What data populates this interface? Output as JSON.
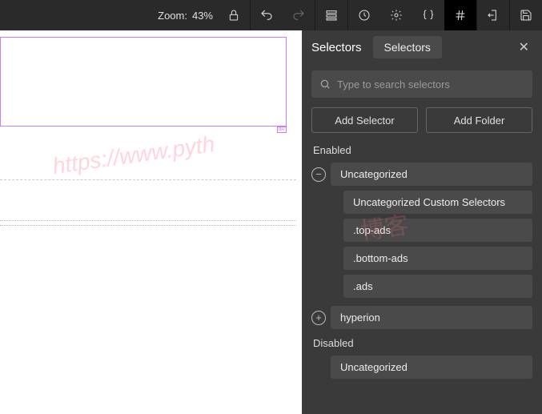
{
  "toolbar": {
    "zoom_label": "Zoom:",
    "zoom_value": "43%"
  },
  "canvas": {
    "selection_label": "div",
    "watermark": "https://www.pyth"
  },
  "panel": {
    "title": "Selectors",
    "tab_label": "Selectors",
    "search_placeholder": "Type to search selectors",
    "add_selector_label": "Add Selector",
    "add_folder_label": "Add Folder",
    "enabled_label": "Enabled",
    "disabled_label": "Disabled",
    "enabled_groups": [
      {
        "name": "Uncategorized",
        "expanded": true,
        "children": [
          "Uncategorized Custom Selectors",
          ".top-ads",
          ".bottom-ads",
          ".ads"
        ]
      },
      {
        "name": "hyperion",
        "expanded": false,
        "children": []
      }
    ],
    "disabled_groups": [
      {
        "name": "Uncategorized"
      }
    ]
  }
}
